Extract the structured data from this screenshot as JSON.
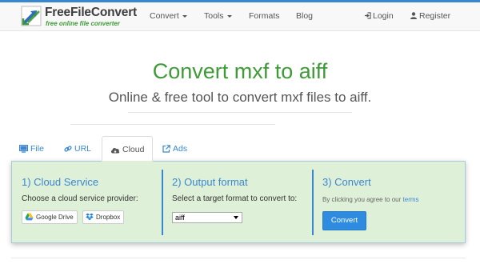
{
  "brand": {
    "name": "FreeFileConvert",
    "tagline": "free online file converter"
  },
  "nav": {
    "items": [
      {
        "label": "Convert",
        "dropdown": true
      },
      {
        "label": "Tools",
        "dropdown": true
      },
      {
        "label": "Formats",
        "dropdown": false
      },
      {
        "label": "Blog",
        "dropdown": false
      }
    ],
    "login_label": "Login",
    "register_label": "Register"
  },
  "hero": {
    "title": "Convert mxf to aiff",
    "subtitle": "Online & free tool to convert mxf files to aiff."
  },
  "tabs": [
    {
      "label": "File",
      "icon": "monitor-icon",
      "active": false
    },
    {
      "label": "URL",
      "icon": "link-icon",
      "active": false
    },
    {
      "label": "Cloud",
      "icon": "cloud-icon",
      "active": true
    },
    {
      "label": "Ads",
      "icon": "external-link-icon",
      "active": false
    }
  ],
  "panel": {
    "step1": {
      "heading": "1) Cloud Service",
      "text": "Choose a cloud service provider:",
      "providers": [
        {
          "label": "Google Drive",
          "icon": "google-drive-icon"
        },
        {
          "label": "Dropbox",
          "icon": "dropbox-icon"
        }
      ]
    },
    "step2": {
      "heading": "2) Output format",
      "text": "Select a target format to convert to:",
      "selected_format": "aiff"
    },
    "step3": {
      "heading": "3) Convert",
      "agree_text": "By clicking you agree to our",
      "terms_link": "terms",
      "button_label": "Convert"
    }
  },
  "colors": {
    "accent": "#3a87d0",
    "brand_green": "#3f9a38",
    "panel_bg": "#dff0d8",
    "button_blue": "#2f8be0"
  }
}
